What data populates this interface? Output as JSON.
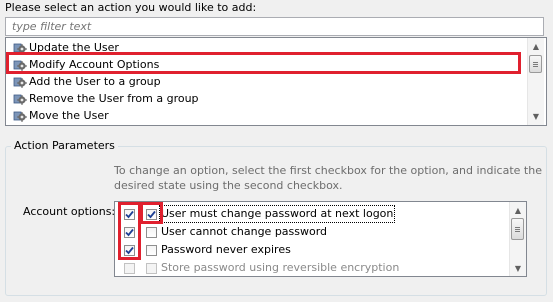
{
  "prompt": "Please select an action you would like to add:",
  "filter": {
    "placeholder": "type filter text",
    "value": ""
  },
  "actions": [
    {
      "label": "Update the User"
    },
    {
      "label": "Modify Account Options",
      "selected": true
    },
    {
      "label": "Add the User to a group"
    },
    {
      "label": "Remove the User from a group"
    },
    {
      "label": "Move the User"
    }
  ],
  "action_parameters": {
    "title": "Action Parameters",
    "hint": "To change an option, select the first checkbox for the option, and indicate the desired state using the second checkbox.",
    "account_options_label": "Account options:",
    "options": [
      {
        "label": "User must change password at next logon",
        "select": true,
        "state": true,
        "enabled": true
      },
      {
        "label": "User cannot change password",
        "select": true,
        "state": false,
        "enabled": true
      },
      {
        "label": "Password never expires",
        "select": true,
        "state": false,
        "enabled": true
      },
      {
        "label": "Store password using reversible encryption",
        "select": false,
        "state": false,
        "enabled": false
      }
    ]
  },
  "colors": {
    "highlight": "#e0202e",
    "check": "#1c3f94"
  },
  "icons": {
    "action_icon": "gear-icon"
  }
}
